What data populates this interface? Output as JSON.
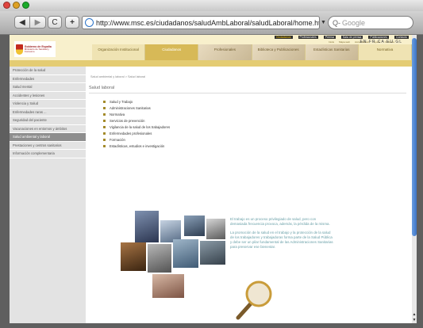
{
  "browser": {
    "url": "http://www.msc.es/ciudadanos/saludAmbLaboral/saludLaboral/home.htm",
    "search_placeholder": "Google",
    "back_label": "◀",
    "forward_label": "▶",
    "reload_label": "C",
    "add_label": "+"
  },
  "site": {
    "logo_line1": "Gobierno de España",
    "logo_line2": "Ministerio de Sanidad y Consumo",
    "top_links": [
      "Ciudadanos",
      "Profesionales",
      "Prensa",
      "Sala de prensa",
      "Publicaciones",
      "Contacto"
    ],
    "mini_links": [
      "Inicio",
      "Mapa web",
      "Accesibilidad",
      "Ayuda",
      "Contacto"
    ],
    "flags": "EN FR CA EU GL",
    "tabs": [
      {
        "label": "Organización Institucional",
        "state": "normal"
      },
      {
        "label": "Ciudadanos",
        "state": "active"
      },
      {
        "label": "Profesionales",
        "state": "photo"
      },
      {
        "label": "Biblioteca y Publicaciones",
        "state": "photo"
      },
      {
        "label": "Estadísticas Sanitarias",
        "state": "photo"
      },
      {
        "label": "Normativa",
        "state": "normal"
      }
    ]
  },
  "sidebar": {
    "items": [
      {
        "label": "Protección de la salud",
        "active": false
      },
      {
        "label": "Enfermedades",
        "active": false
      },
      {
        "label": "Salud mental",
        "active": false
      },
      {
        "label": "Accidentes y lesiones",
        "active": false
      },
      {
        "label": "Violencia y Salud",
        "active": false
      },
      {
        "label": "Enfermedades raras ...",
        "active": false
      },
      {
        "label": "Seguridad del paciente",
        "active": false
      },
      {
        "label": "Vacunaciones en entornos y ámbitos",
        "active": false
      },
      {
        "label": "Salud ambiental y laboral",
        "active": true
      },
      {
        "label": "Prestaciones y centros sanitarios",
        "active": false
      },
      {
        "label": "Información complementaria",
        "active": false
      }
    ]
  },
  "content": {
    "breadcrumb": "Salud ambiental y laboral > Salud laboral",
    "title": "Salud laboral",
    "links": [
      "Salud y Trabajo",
      "Administraciones Sanitarias",
      "Normativa",
      "Servicios de prevención",
      "Vigilancia de la salud de los trabajadores",
      "Enfermedades profesionales",
      "Formación",
      "Estadísticas, estudios e investigación"
    ],
    "quote_p1": "El trabajo es un proceso privilegiado de salud, pero con demasiada frecuencia provoca, además, la pérdida de la misma.",
    "quote_p2": "La promoción de la salud en el trabajo y la protección de la salud de los trabajadores y trabajadoras forma parte de la Salud Pública y debe ser un pilar fundamental de las Administraciones Sanitarias para preservar ese bienestar."
  },
  "colors": {
    "header_bg": "#f8f0cc",
    "gold_band": "#e4cc73",
    "active_tab": "#d7b957",
    "sidebar_bg": "#e3e3e3",
    "sidebar_active": "#8e8e8e",
    "quote_text": "#6aa0a8"
  }
}
